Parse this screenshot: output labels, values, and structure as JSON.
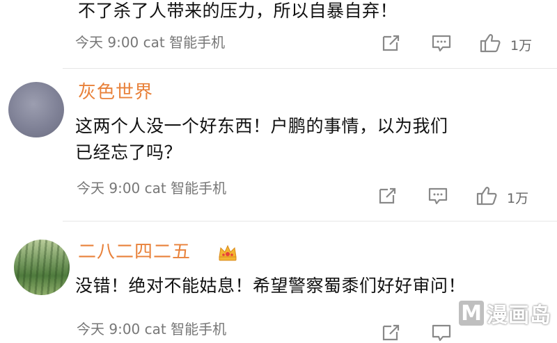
{
  "comments": [
    {
      "username": "",
      "text_lines": [
        "不了杀了人带来的压力，所以自暴自弃！"
      ],
      "time": "今天 9:00",
      "device": "cat 智能手机",
      "likes": "1万"
    },
    {
      "username": "灰色世界",
      "text_lines": [
        "这两个人没一个好东西！户鹏的事情，以为我们",
        "已经忘了吗？"
      ],
      "time": "今天 9:00",
      "device": "cat 智能手机",
      "likes": "1万"
    },
    {
      "username": "二八二四二五",
      "text_lines": [
        "没错！绝对不能姑息！希望警察蜀黍们好好审问！"
      ],
      "time": "今天 9:00",
      "device": "cat 智能手机",
      "likes": ""
    }
  ],
  "watermark": {
    "letter": "M",
    "text": "漫画岛"
  },
  "colors": {
    "username": "#e8813a",
    "meta": "#777777",
    "icon": "#888888"
  },
  "icons": [
    "share-icon",
    "comment-icon",
    "thumbs-up-icon",
    "vip-crown-icon"
  ]
}
